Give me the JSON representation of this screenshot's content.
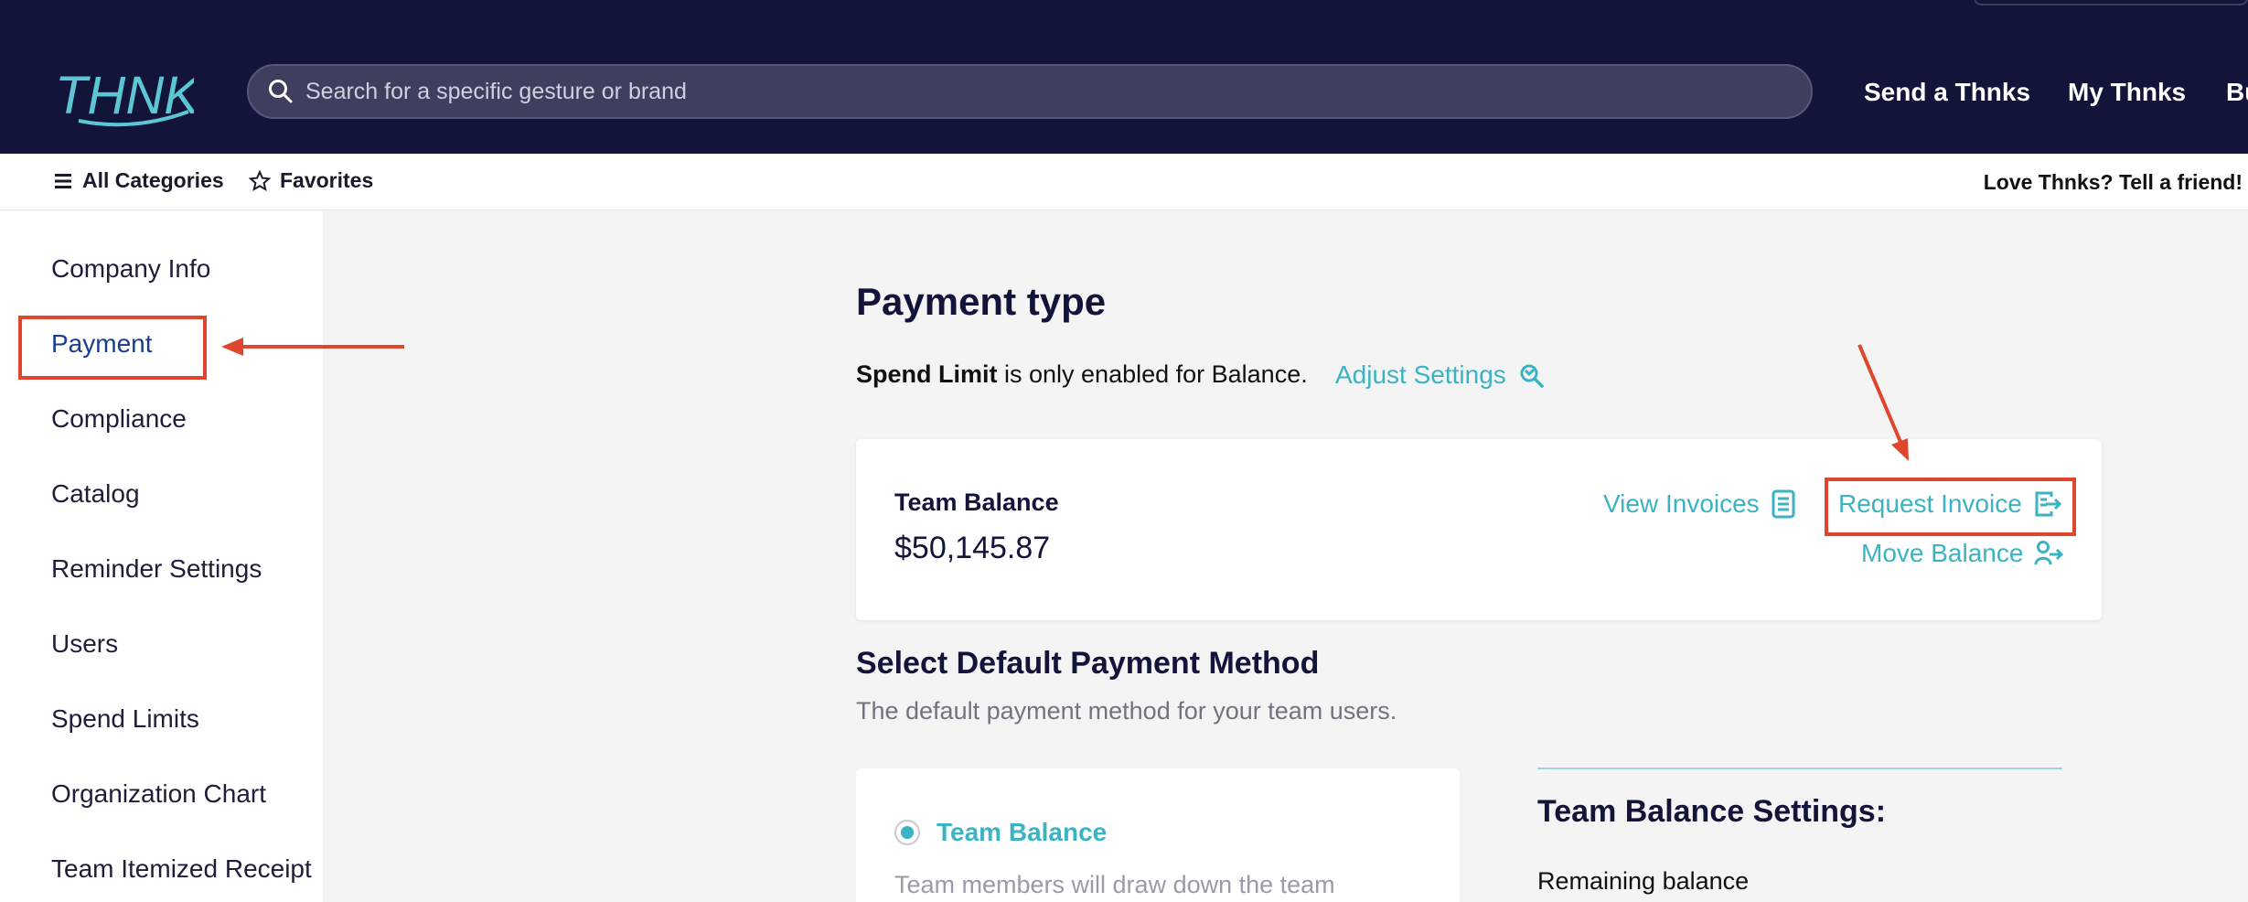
{
  "header": {
    "logo_text": "THNKS",
    "search": {
      "placeholder": "Search for a specific gesture or brand"
    },
    "nav": [
      "Send a Thnks",
      "My Thnks",
      "Bu"
    ]
  },
  "subbar": {
    "all_categories": "All Categories",
    "favorites": "Favorites",
    "promo": "Love Thnks? Tell a friend!"
  },
  "sidebar": {
    "items": [
      {
        "label": "Company Info"
      },
      {
        "label": "Payment",
        "active": true
      },
      {
        "label": "Compliance"
      },
      {
        "label": "Catalog"
      },
      {
        "label": "Reminder Settings"
      },
      {
        "label": "Users"
      },
      {
        "label": "Spend Limits"
      },
      {
        "label": "Organization Chart"
      },
      {
        "label": "Team Itemized Receipt"
      }
    ]
  },
  "main": {
    "title": "Payment type",
    "spend_limit_bold": "Spend Limit",
    "spend_limit_rest": " is only enabled for Balance.",
    "adjust_settings": "Adjust Settings",
    "balance_card": {
      "label": "Team Balance",
      "amount": "$50,145.87",
      "view_invoices": "View Invoices",
      "request_invoice": "Request Invoice",
      "move_balance": "Move Balance"
    },
    "select_title": "Select Default Payment Method",
    "select_subtitle": "The default payment method for your team users.",
    "method": {
      "label": "Team Balance",
      "description": "Team members will draw down the team",
      "selected": true
    },
    "settings_title": "Team Balance Settings:",
    "remaining_label": "Remaining balance"
  },
  "colors": {
    "header_bg": "#13143a",
    "accent": "#3cb3c2",
    "annotation": "#e0452e",
    "active_nav": "#1a3d8f"
  }
}
